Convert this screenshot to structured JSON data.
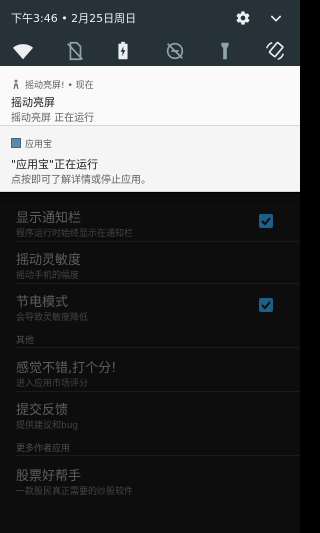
{
  "status_bar": {
    "time_date": "下午3:46 • 2月25日周日",
    "settings_icon": "gear-icon",
    "expand_icon": "chevron-down-icon"
  },
  "quick_settings": [
    {
      "name": "wifi-icon"
    },
    {
      "name": "sim-off-icon"
    },
    {
      "name": "battery-saver-icon"
    },
    {
      "name": "do-not-disturb-off-icon"
    },
    {
      "name": "flashlight-icon"
    },
    {
      "name": "auto-rotate-icon"
    }
  ],
  "notifications": [
    {
      "app": "摇动亮屏! • 现在",
      "title": "摇动亮屏",
      "text": "摇动亮屏 正在运行"
    },
    {
      "app": "应用宝",
      "title": "\"应用宝\"正在运行",
      "text": "点按即可了解详情或停止应用。"
    }
  ],
  "prefs": {
    "items": [
      {
        "title": "显示通知栏",
        "subtitle": "程序运行时始终显示在通知栏",
        "checked": true
      },
      {
        "title": "摇动灵敏度",
        "subtitle": "摇动手机的幅度"
      },
      {
        "title": "节电模式",
        "subtitle": "会导致灵敏度降低",
        "checked": true
      }
    ],
    "section_other": "其他",
    "other_items": [
      {
        "title": "感觉不错,打个分!",
        "subtitle": "进入应用市场评分"
      },
      {
        "title": "提交反馈",
        "subtitle": "提供建议和bug"
      }
    ],
    "section_more": "更多作者应用",
    "more_items": [
      {
        "title": "股票好帮手",
        "subtitle": "一款股民真正需要的炒股软件"
      }
    ]
  },
  "colors": {
    "shade": "#263238",
    "check_accent": "#1e5f8a"
  }
}
